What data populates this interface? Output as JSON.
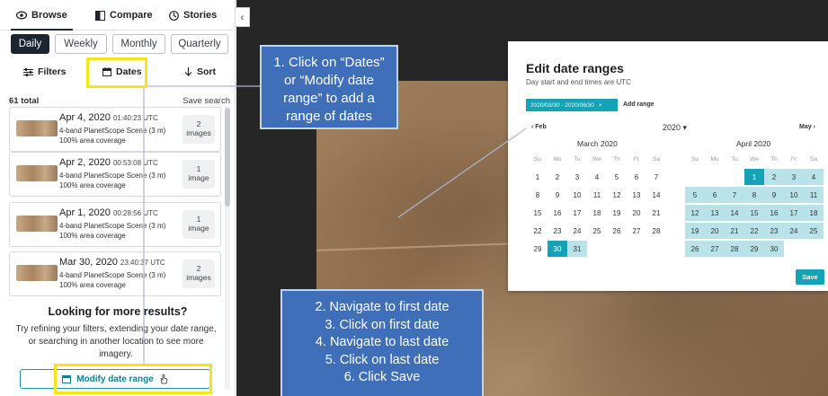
{
  "nav": {
    "tabs": [
      {
        "label": "Browse",
        "icon": "eye-icon"
      },
      {
        "label": "Compare",
        "icon": "compare-icon"
      },
      {
        "label": "Stories",
        "icon": "stories-icon"
      }
    ],
    "collapse": "‹"
  },
  "periods": [
    "Daily",
    "Weekly",
    "Monthly",
    "Quarterly"
  ],
  "filters": {
    "filters_label": "Filters",
    "dates_label": "Dates",
    "sort_label": "Sort"
  },
  "list": {
    "total": "61 total",
    "save_search": "Save search",
    "items": [
      {
        "date": "Apr 4, 2020",
        "time": "01:40:23 UTC",
        "desc": "4-band PlanetScope Scene (3 m)",
        "coverage": "100% area coverage",
        "count": "2",
        "count_unit": "images"
      },
      {
        "date": "Apr 2, 2020",
        "time": "00:53:08 UTC",
        "desc": "4-band PlanetScope Scene (3 m)",
        "coverage": "100% area coverage",
        "count": "1",
        "count_unit": "image"
      },
      {
        "date": "Apr 1, 2020",
        "time": "00:28:56 UTC",
        "desc": "4-band PlanetScope Scene (3 m)",
        "coverage": "100% area coverage",
        "count": "1",
        "count_unit": "image"
      },
      {
        "date": "Mar 30, 2020",
        "time": "23:40:37 UTC",
        "desc": "4-band PlanetScope Scene (3 m)",
        "coverage": "100% area coverage",
        "count": "2",
        "count_unit": "images"
      }
    ]
  },
  "more": {
    "title": "Looking for more results?",
    "text": "Try refining your filters, extending your date range, or searching in another location to see more imagery.",
    "button": "Modify date range"
  },
  "dialog": {
    "title": "Edit date ranges",
    "subtitle": "Day start and end times are UTC",
    "chip": "2020/03/30 - 2020/06/30",
    "chip_close": "×",
    "add_range": "Add range",
    "prev": "‹  Feb",
    "next": "May  ›",
    "year": "2020 ▾",
    "months": [
      {
        "title": "March 2020",
        "weekdays": [
          "Su",
          "Mo",
          "Tu",
          "We",
          "Th",
          "Fr",
          "Sa"
        ]
      },
      {
        "title": "April 2020",
        "weekdays": [
          "Su",
          "Mo",
          "Tu",
          "We",
          "Th",
          "Fr",
          "Sa"
        ]
      }
    ],
    "save": "Save"
  },
  "callouts": {
    "first": [
      "1. Click on “Dates”",
      "or “Modify date",
      "range” to add a",
      "range of dates"
    ],
    "second": [
      "2. Navigate to first date",
      "3. Click on first date",
      "4. Navigate to last date",
      "5. Click on last date",
      "6. Click Save"
    ]
  },
  "colors": {
    "accent": "#14a3b5",
    "callout": "#3f6fb8",
    "highlight": "#f5e51a",
    "range_fill": "#b9e3e9"
  }
}
